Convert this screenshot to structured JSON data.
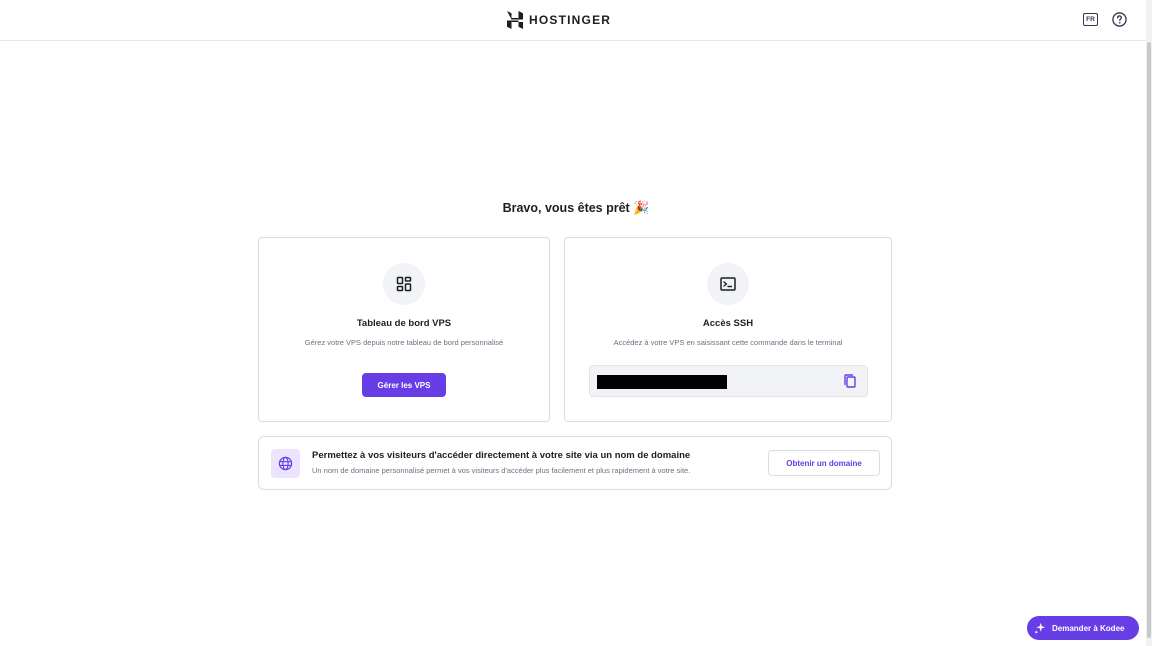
{
  "header": {
    "brand": "HOSTINGER",
    "language_code": "FR"
  },
  "main": {
    "heading": "Bravo, vous êtes prêt",
    "heading_emoji": "🎉"
  },
  "cards": {
    "vps": {
      "icon": "dashboard-icon",
      "title": "Tableau de bord VPS",
      "description": "Gérez votre VPS depuis notre tableau de bord personnalisé",
      "button_label": "Gérer les VPS"
    },
    "ssh": {
      "icon": "terminal-icon",
      "title": "Accès SSH",
      "description": "Accédez à votre VPS en saisissant cette commande dans le terminal",
      "command_value": ""
    }
  },
  "domain_banner": {
    "icon": "globe-icon",
    "title": "Permettez à vos visiteurs d'accéder directement à votre site via un nom de domaine",
    "description": "Un nom de domaine personnalisé permet à vos visiteurs d'accéder plus facilement et plus rapidement à votre site.",
    "button_label": "Obtenir un domaine"
  },
  "assistant": {
    "button_label": "Demander à Kodee"
  },
  "colors": {
    "accent": "#673de6",
    "accent_light": "#ebe4ff",
    "text_primary": "#1d1e20",
    "text_secondary": "#6d7081",
    "border": "#dadce0",
    "surface": "#f2f3f6"
  }
}
